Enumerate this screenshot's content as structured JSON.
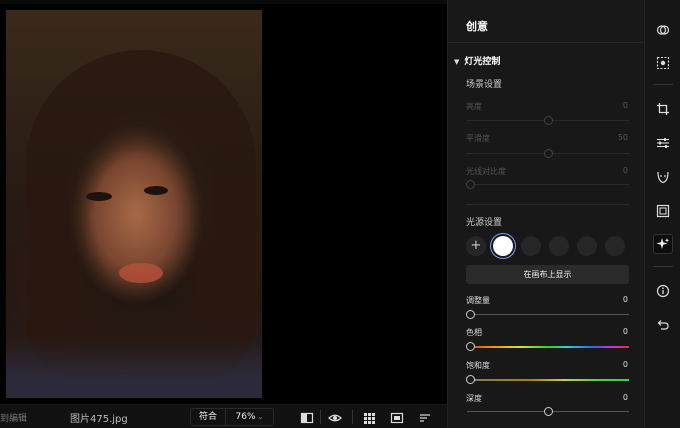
{
  "canvas": {
    "photo_description_icon": "portrait-photo"
  },
  "bottom_bar": {
    "left_label": "到编辑",
    "filename": "图片475.jpg",
    "fit_label": "符合",
    "zoom_value": "76%"
  },
  "panel": {
    "title": "创意",
    "section_title": "灯光控制",
    "scene": {
      "title": "场景设置",
      "sliders": [
        {
          "label": "亮度",
          "value": "0",
          "position": 0.5
        },
        {
          "label": "平滑度",
          "value": "50",
          "position": 0.5
        },
        {
          "label": "光线对比度",
          "value": "0",
          "position": 0.0
        }
      ]
    },
    "light_source": {
      "title": "光源设置",
      "show_on_canvas_label": "在画布上显示",
      "sliders": [
        {
          "label": "调整量",
          "value": "0",
          "position": 0.0
        },
        {
          "label": "色相",
          "value": "0",
          "position": 0.0
        },
        {
          "label": "饱和度",
          "value": "0",
          "position": 0.0
        },
        {
          "label": "深度",
          "value": "0",
          "position": 0.5
        }
      ]
    }
  },
  "toolbar": {
    "icons": [
      "overlap-circles-icon",
      "select-subject-icon",
      "crop-icon",
      "adjust-sliders-icon",
      "face-retouch-icon",
      "frame-icon",
      "sparkle-creative-icon",
      "info-icon",
      "undo-icon"
    ],
    "active": "sparkle-creative-icon"
  },
  "colors": {
    "panel_bg": "#181818",
    "accent_selected_ring": "#7aa0ff"
  }
}
